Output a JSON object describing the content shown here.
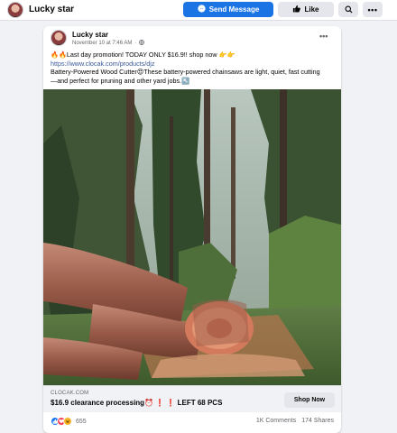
{
  "header": {
    "page_name": "Lucky star",
    "send_message_label": "Send Message",
    "like_label": "Like",
    "more_label": "•••"
  },
  "post": {
    "author": "Lucky star",
    "timestamp": "November 10 at 7:46 AM",
    "separator": "·",
    "options_label": "•••",
    "text_line1": "🔥🔥Last day promotion! TODAY ONLY $16.9!! shop now 👉👉",
    "link": "https://www.clocak.com/products/djz",
    "text_line2": "Battery-Powered Wood Cutter😍These battery-powered chainsaws are light, quiet, fast cutting",
    "text_line3": "—and perfect for pruning and other yard jobs.↖️"
  },
  "link_preview": {
    "domain": "CLOCAK.COM",
    "title": "$16.9 clearance processing⏰ ❗ ❗ LEFT 68 PCS",
    "shop_now_label": "Shop Now"
  },
  "stats": {
    "reaction_count": "655",
    "comments": "1K Comments",
    "shares": "174 Shares"
  },
  "colors": {
    "accent": "#1b74e4",
    "like_reaction": "#1877f2",
    "love_reaction": "#f33e58",
    "haha_reaction": "#f7b125"
  },
  "icons": {
    "messenger": "messenger-icon",
    "like": "thumbs-up-icon",
    "search": "search-icon",
    "globe": "globe-icon"
  }
}
